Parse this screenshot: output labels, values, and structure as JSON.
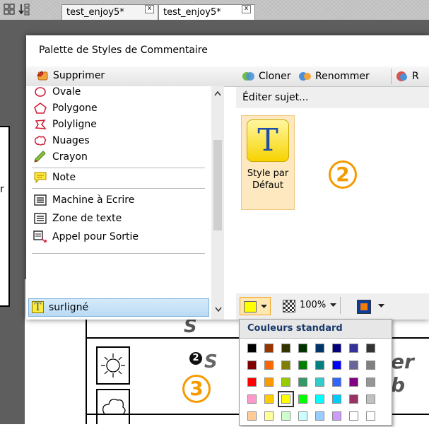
{
  "tabs": [
    {
      "label": "test_enjoy5*",
      "close": "x"
    },
    {
      "label": "test_enjoy5*",
      "close": "x"
    }
  ],
  "left_fragment": "r",
  "palette": {
    "title": "Palette de Styles de Commentaire",
    "delete_label": "Supprimer",
    "toolbar": {
      "clone": "Cloner",
      "rename": "Renommer",
      "partial": "R"
    },
    "edit_subject": "Éditer sujet...",
    "items": [
      {
        "label": "Ovale",
        "icon": "ellipse-icon"
      },
      {
        "label": "Polygone",
        "icon": "polygon-icon"
      },
      {
        "label": "Polyligne",
        "icon": "polyline-icon"
      },
      {
        "label": "Nuages",
        "icon": "cloud-icon"
      },
      {
        "label": "Crayon",
        "icon": "pencil-icon"
      },
      {
        "label": "Note",
        "icon": "note-icon"
      },
      {
        "label": "Machine à Ecrire",
        "icon": "typewriter-icon"
      },
      {
        "label": "Zone de texte",
        "icon": "textbox-icon"
      },
      {
        "label": "Appel pour Sortie",
        "icon": "callout-icon"
      }
    ],
    "selected_item": "surligné",
    "style_tile": {
      "line1": "Style par",
      "line2": "Défaut",
      "letter": "T"
    },
    "zoom_value": "100%",
    "badge_two": "2",
    "badge_three": "3"
  },
  "color_menu": {
    "title": "Couleurs standard",
    "selected": "#ffff00",
    "rows": [
      [
        "#000000",
        "#993300",
        "#333300",
        "#003300",
        "#003366",
        "#000080",
        "#333399",
        "#333333"
      ],
      [
        "#800000",
        "#ff6600",
        "#808000",
        "#008000",
        "#008080",
        "#0000ff",
        "#666699",
        "#808080"
      ],
      [
        "#ff0000",
        "#ff9900",
        "#99cc00",
        "#339966",
        "#33cccc",
        "#3366ff",
        "#800080",
        "#969696"
      ],
      [
        "#ff99cc",
        "#ffcc00",
        "#ffff00",
        "#00ff00",
        "#00ffff",
        "#00ccff",
        "#993366",
        "#c0c0c0"
      ],
      [
        "#ffcc99",
        "#ffff99",
        "#ccffcc",
        "#ccffff",
        "#99ccff",
        "#cc99ff",
        "#ffffff",
        "#ffffff"
      ]
    ]
  },
  "background_doc": {
    "fragment_top": "S",
    "fragment_mid": "S",
    "fragment_right": "er b",
    "bullet": "2"
  }
}
